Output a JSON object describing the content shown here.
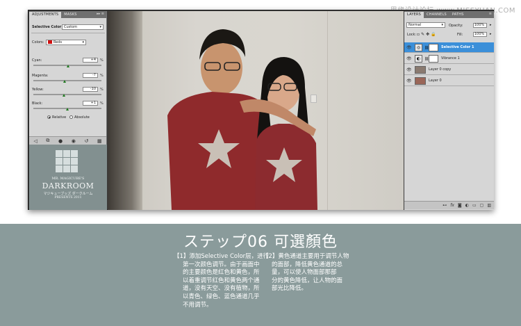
{
  "watermark": "思缘设计论坛 www.MISSYUAN.COM",
  "adjustments": {
    "tabs": [
      "ADJUSTMENTS",
      "MASKS"
    ],
    "title": "Selective Color",
    "preset": "Custom",
    "colors_label": "Colors:",
    "colors_value": "Reds",
    "sliders": [
      {
        "label": "Cyan:",
        "value": "+4",
        "unit": "%",
        "level": 0.52
      },
      {
        "label": "Magenta:",
        "value": "-7",
        "unit": "%",
        "level": 0.46
      },
      {
        "label": "Yellow:",
        "value": "-10",
        "unit": "%",
        "level": 0.45
      },
      {
        "label": "Black:",
        "value": "+1",
        "unit": "%",
        "level": 0.505
      }
    ],
    "method": {
      "relative": "Relative",
      "absolute": "Absolute",
      "selected": "Relative"
    },
    "footer_icons": [
      "back-icon",
      "clip-icon",
      "visibility-icon",
      "eye-icon",
      "reset-icon",
      "delete-icon"
    ]
  },
  "logo": {
    "line1": "MR. MAGICUBE'S",
    "line2": "DARKROOM",
    "line3": "マジキューブッズ ダークルーム",
    "line4": "PRESENTS 2011"
  },
  "layers": {
    "tabs": [
      "LAYERS",
      "CHANNELS",
      "PATHS"
    ],
    "blend_mode": "Normal",
    "opacity_label": "Opacity:",
    "opacity_value": "100%",
    "lock_label": "Lock:",
    "fill_label": "Fill:",
    "fill_value": "100%",
    "items": [
      {
        "name": "Selective Color 1",
        "selected": true
      },
      {
        "name": "Vibrance 1",
        "selected": false
      },
      {
        "name": "Layer 0 copy",
        "selected": false
      },
      {
        "name": "Layer 0",
        "selected": false
      }
    ],
    "footer_icons": [
      "link-icon",
      "fx-icon",
      "mask-icon",
      "adjustment-icon",
      "group-icon",
      "new-layer-icon",
      "trash-icon"
    ]
  },
  "caption": {
    "title": "ステップ06 可選顏色",
    "col1": [
      "【1】添加Selective Color层，进行",
      "第一次颜色调节。由于画面中",
      "的主要颜色是红色和黄色，所",
      "以着重调节红色和黄色两个通",
      "道，没有天空、没有植物，所",
      "以青色、绿色、蓝色通道几乎",
      "不用调节。"
    ],
    "col2": [
      "【2】黄色通道主要用于调节人物",
      "的面部，降低黄色通道的总",
      "量，可以使人物面部那部",
      "分的黄色降低，让人物的面",
      "部光比降低。"
    ]
  }
}
